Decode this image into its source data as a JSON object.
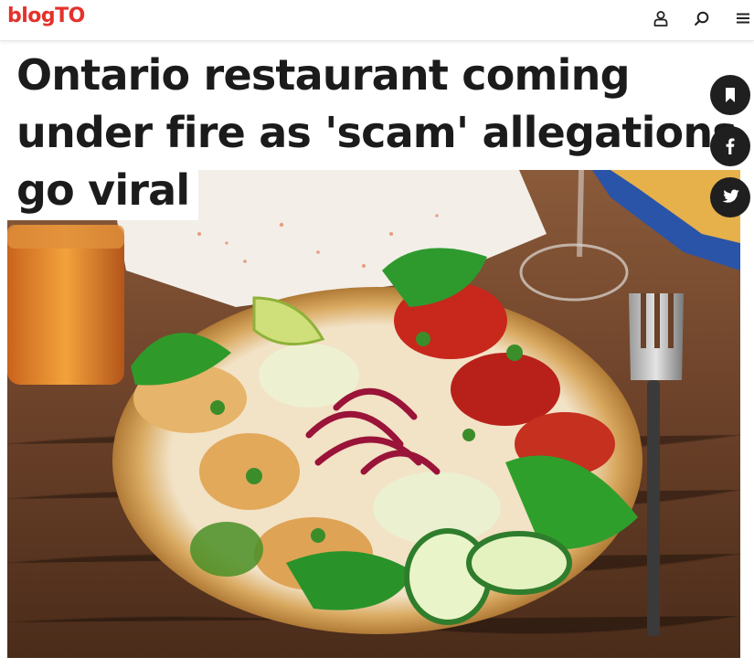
{
  "header": {
    "logo_blog": "blog",
    "logo_to": "TO",
    "icons": [
      "user-icon",
      "search-icon",
      "menu-icon"
    ]
  },
  "article": {
    "title_lines": [
      "Ontario restaurant coming",
      "under fire as 'scam' allegations",
      "go viral"
    ]
  },
  "share": {
    "icons": [
      "bookmark-icon",
      "facebook-icon",
      "twitter-icon"
    ]
  },
  "colors": {
    "brand": "#e4322b",
    "title": "#1b1b1b",
    "share_bg": "#1f1f1f"
  }
}
